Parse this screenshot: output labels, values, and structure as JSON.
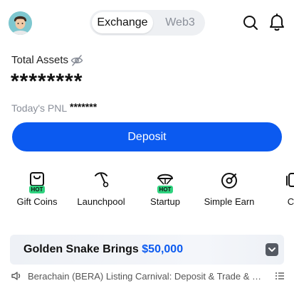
{
  "header": {
    "tabs": [
      "Exchange",
      "Web3"
    ],
    "active_tab": "Exchange"
  },
  "assets": {
    "label": "Total Assets",
    "value": "********",
    "pnl_label": "Today's PNL",
    "pnl_value": "*******"
  },
  "deposit_label": "Deposit",
  "actions": [
    {
      "label": "Gift Coins",
      "icon": "gift-card-icon",
      "badge": "HOT"
    },
    {
      "label": "Launchpool",
      "icon": "pickaxe-icon"
    },
    {
      "label": "Startup",
      "icon": "parachute-icon",
      "badge": "HOT"
    },
    {
      "label": "Simple Earn",
      "icon": "earn-target-icon"
    },
    {
      "label": "Co",
      "icon": "copy-trade-icon"
    }
  ],
  "banner": {
    "text": "Golden Snake Brings ",
    "amount": "$50,000"
  },
  "news": {
    "text": "Berachain (BERA) Listing Carnival: Deposit & Trade & Re..."
  },
  "colors": {
    "brand_blue": "#0b5af0",
    "hot_badge": "#2fd37f"
  }
}
